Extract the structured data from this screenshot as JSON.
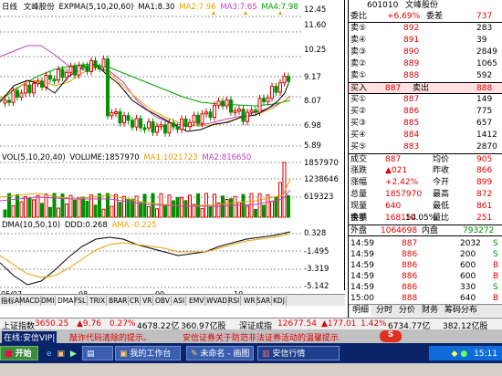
{
  "chart_header": {
    "period_label": "日线",
    "stock_name": "文峰股份",
    "ma_title": "EXPMA(5,10,20,60)",
    "ma1": "MA1:8.30",
    "ma2": "MA2:7.96",
    "ma3": "MA3:7.65",
    "ma4": "MA4:7.98"
  },
  "price_axis": [
    "12.45",
    "11.60",
    "10.25",
    "9.17",
    "8.07",
    "6.98",
    "5.89"
  ],
  "volume_header": {
    "title": "VOL(5,10,20,40)",
    "vol": "VOLUME:1857970",
    "ma1": "MA1:1021723",
    "ma2": "MA2:816650"
  },
  "volume_axis": [
    "1857970",
    "1238646",
    "619323"
  ],
  "dma_header": {
    "title": "DMA(10,50,10)",
    "ddd": "DDD:0.268",
    "ama": "AMA:-0.225"
  },
  "dma_axis": [
    "0.328",
    "-1.495",
    "-3.319",
    "-5.142"
  ],
  "date_labels": [
    "05/07",
    "08",
    "09",
    "10"
  ],
  "bottom_tabs": [
    "指标A",
    "MACD",
    "DMI",
    "DMA",
    "FSL",
    "TRIX",
    "BRAR",
    "CR",
    "VR",
    "OBV",
    "ASI",
    "EMV",
    "WVAD",
    "RSI",
    "WR",
    "SAR",
    "KDJ"
  ],
  "quote": {
    "code": "601010",
    "name": "文峰股份",
    "weibi_label": "委比",
    "weibi_value": "+6.69%",
    "weicha_label": "委差",
    "weicha_value": "737",
    "sells": [
      {
        "label": "卖⑤",
        "price": "892",
        "vol": "283"
      },
      {
        "label": "卖④",
        "price": "891",
        "vol": "39"
      },
      {
        "label": "卖③",
        "price": "890",
        "vol": "2849"
      },
      {
        "label": "卖②",
        "price": "889",
        "vol": "1065"
      },
      {
        "label": "卖①",
        "price": "888",
        "vol": "592"
      }
    ],
    "buyin_label": "买入",
    "buyin_price": "887",
    "sellout_label": "卖出",
    "sellout_price": "888",
    "buys": [
      {
        "label": "买①",
        "price": "887",
        "vol": "149"
      },
      {
        "label": "买②",
        "price": "886",
        "vol": "775"
      },
      {
        "label": "买③",
        "price": "885",
        "vol": "657"
      },
      {
        "label": "买④",
        "price": "884",
        "vol": "1412"
      },
      {
        "label": "买⑤",
        "price": "883",
        "vol": "2870"
      }
    ],
    "stats": [
      {
        "l1": "成交",
        "v1": "887",
        "l2": "均价",
        "v2": "905"
      },
      {
        "l1": "涨跌",
        "v1": "▲021",
        "l2": "昨收",
        "v2": "866"
      },
      {
        "l1": "涨幅",
        "v1": "+2.42%",
        "l2": "今开",
        "v2": "899"
      },
      {
        "l1": "总量",
        "v1": "1857970",
        "l2": "最高",
        "v2": "872"
      },
      {
        "l1": "现量",
        "v1": "640",
        "l2": "最低",
        "v2": "861"
      },
      {
        "l1": "金额",
        "v1": "168154",
        "l2": "量比",
        "v2": "251"
      }
    ],
    "turnover_label": "换手",
    "turnover_value": "10.05%",
    "outer_label": "外盘",
    "outer_value": "1064698",
    "inner_label": "内盘",
    "inner_value": "793272",
    "ticks": [
      {
        "time": "14:59",
        "price": "887",
        "vol": "2032",
        "flag": "S"
      },
      {
        "time": "14:59",
        "price": "886",
        "vol": "200",
        "flag": "S"
      },
      {
        "time": "14:59",
        "price": "886",
        "vol": "600",
        "flag": "B"
      },
      {
        "time": "14:59",
        "price": "886",
        "vol": "600",
        "flag": "B"
      },
      {
        "time": "14:59",
        "price": "886",
        "vol": "330",
        "flag": "S"
      },
      {
        "time": "15:00",
        "price": "888",
        "vol": "640",
        "flag": "B"
      }
    ],
    "tabs": [
      "明细",
      "分时",
      "分价",
      "财务",
      "筹码分布"
    ]
  },
  "status_bar": {
    "sh_label": "上证指数",
    "sh_value": "3650.25",
    "sh_change": "▲9.76",
    "sh_pct": "0.27%",
    "sh_amount": "4678.22亿",
    "sh_vol": "360.97亿股",
    "sz_label": "深证成指",
    "sz_value": "12677.54",
    "sz_change": "▲177.01",
    "sz_pct": "1.42%",
    "sz_amount": "6734.77亿",
    "sz_vol": "382.12亿股"
  },
  "ticker": {
    "left": "在线:安信VIP|",
    "msg1": "敲诈代码清除的提示。",
    "msg2": "安信证券关于防范非法证券活动的温馨提示"
  },
  "taskbar": {
    "start": "开始",
    "items": [
      "",
      "我的工作台",
      "未命名 - 画图",
      "安信行情"
    ],
    "clock": "15:11"
  }
}
